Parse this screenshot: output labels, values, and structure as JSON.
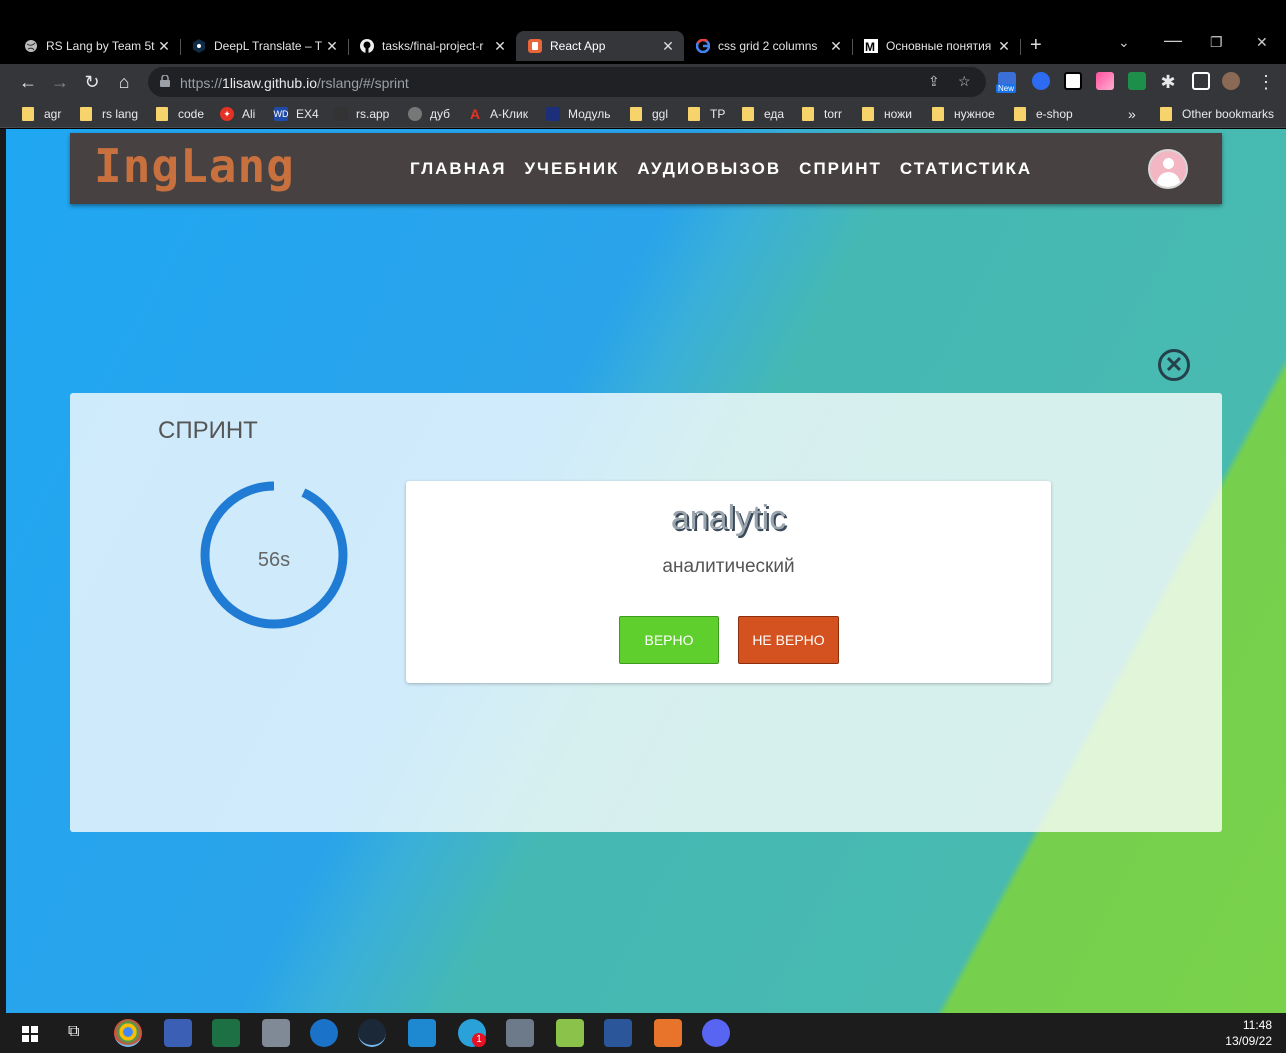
{
  "browser": {
    "tabs": [
      {
        "title": "RS Lang by Team 5t",
        "icon": "globe-icon",
        "active": false
      },
      {
        "title": "DeepL Translate – T",
        "icon": "deepl-icon",
        "active": false
      },
      {
        "title": "tasks/final-project-r",
        "icon": "github-icon",
        "active": false
      },
      {
        "title": "React App",
        "icon": "react-app-icon",
        "active": true
      },
      {
        "title": "css grid 2 columns",
        "icon": "google-icon",
        "active": false
      },
      {
        "title": "Основные понятия",
        "icon": "m-icon",
        "active": false
      }
    ],
    "new_tab": "+",
    "close_glyph": "✕",
    "url_host": "1lisaw.github.io",
    "url_prefix": "https://",
    "url_path": "/rslang/#/sprint",
    "extension_badge": "New"
  },
  "bookmarks": {
    "items": [
      "agr",
      "rs lang",
      "code",
      "Ali",
      "EX4",
      "rs.app",
      "дуб",
      "А-Клик",
      "Модуль",
      "ggl",
      "TP",
      "еда",
      "torr",
      "ножи",
      "нужное",
      "e-shop"
    ],
    "more": "»",
    "other": "Other bookmarks"
  },
  "app": {
    "logo": "IngLang",
    "nav": [
      "ГЛАВНАЯ",
      "УЧЕБНИК",
      "АУДИОВЫЗОВ",
      "СПРИНТ",
      "СТАТИСТИКА"
    ],
    "close_glyph": "✕"
  },
  "sprint": {
    "title": "СПРИНТ",
    "timer_label": "56s",
    "timer_fraction": 0.93,
    "word": "analytic",
    "translation": "аналитический",
    "correct_label": "ВЕРНО",
    "wrong_label": "НЕ ВЕРНО"
  },
  "taskbar": {
    "time": "11:48",
    "date": "13/09/22",
    "notification_count": "1"
  }
}
